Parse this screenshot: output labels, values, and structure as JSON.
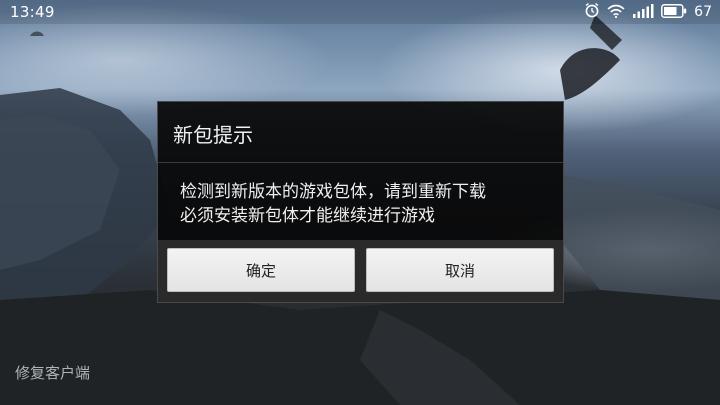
{
  "status_bar": {
    "time": "13:49",
    "battery_level": "67",
    "icons": [
      "alarm-icon",
      "wifi-icon",
      "signal-icon",
      "battery-icon"
    ]
  },
  "dialog": {
    "title": "新包提示",
    "message_line1": "检测到新版本的游戏包体，请到重新下载",
    "message_line2": "必须安装新包体才能继续进行游戏",
    "confirm_label": "确定",
    "cancel_label": "取消"
  },
  "repair_client_label": "修复客户端"
}
